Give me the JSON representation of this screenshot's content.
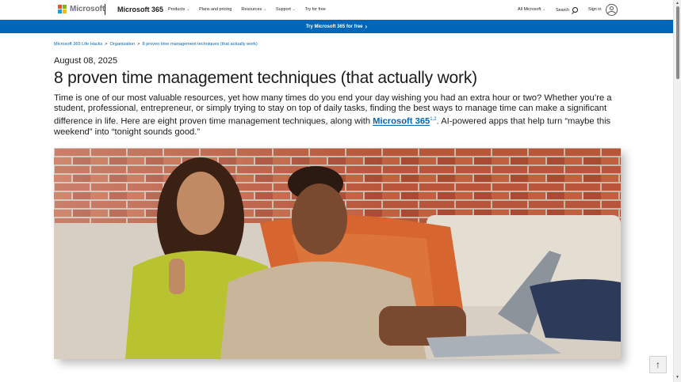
{
  "header": {
    "logo_text": "Microsoft",
    "product": "Microsoft 365",
    "nav": [
      {
        "label": "Products",
        "has_menu": true
      },
      {
        "label": "Plans and pricing",
        "has_menu": false
      },
      {
        "label": "Resources",
        "has_menu": true
      },
      {
        "label": "Support",
        "has_menu": true
      },
      {
        "label": "Try for free",
        "has_menu": false
      }
    ],
    "all_microsoft": "All Microsoft",
    "search": "Search",
    "sign_in": "Sign in"
  },
  "banner": {
    "label": "Try Microsoft 365 for free"
  },
  "breadcrumb": [
    "Microsoft 365 Life Hacks",
    "Organization",
    "8 proven time management techniques (that actually work)"
  ],
  "breadcrumb_sep": ">",
  "article": {
    "date": "August 08, 2025",
    "title": "8 proven time management techniques (that actually work)",
    "intro_before": "Time is one of our most valuable resources, yet how many times do you end your day wishing you had an extra hour or two? Whether you’re a student, professional, entrepreneur, or simply trying to stay on top of daily tasks, finding the best ways to manage time can make a significant difference in life. Here are eight proven time management techniques, along with ",
    "intro_link": "Microsoft 365",
    "intro_sup": "1,2",
    "intro_after": ". AI-powered apps that help turn “maybe this weekend” into “tonight sounds good.”"
  },
  "colors": {
    "brand_blue": "#0067b8",
    "ms_red": "#f25022",
    "ms_green": "#7fba00",
    "ms_blue": "#00a4ef",
    "ms_yellow": "#ffb900"
  },
  "icons": {
    "chevron": "⌄",
    "banner_arrow": "›",
    "back_to_top": "↑",
    "scroll_up": "▲",
    "scroll_down": "▼"
  }
}
